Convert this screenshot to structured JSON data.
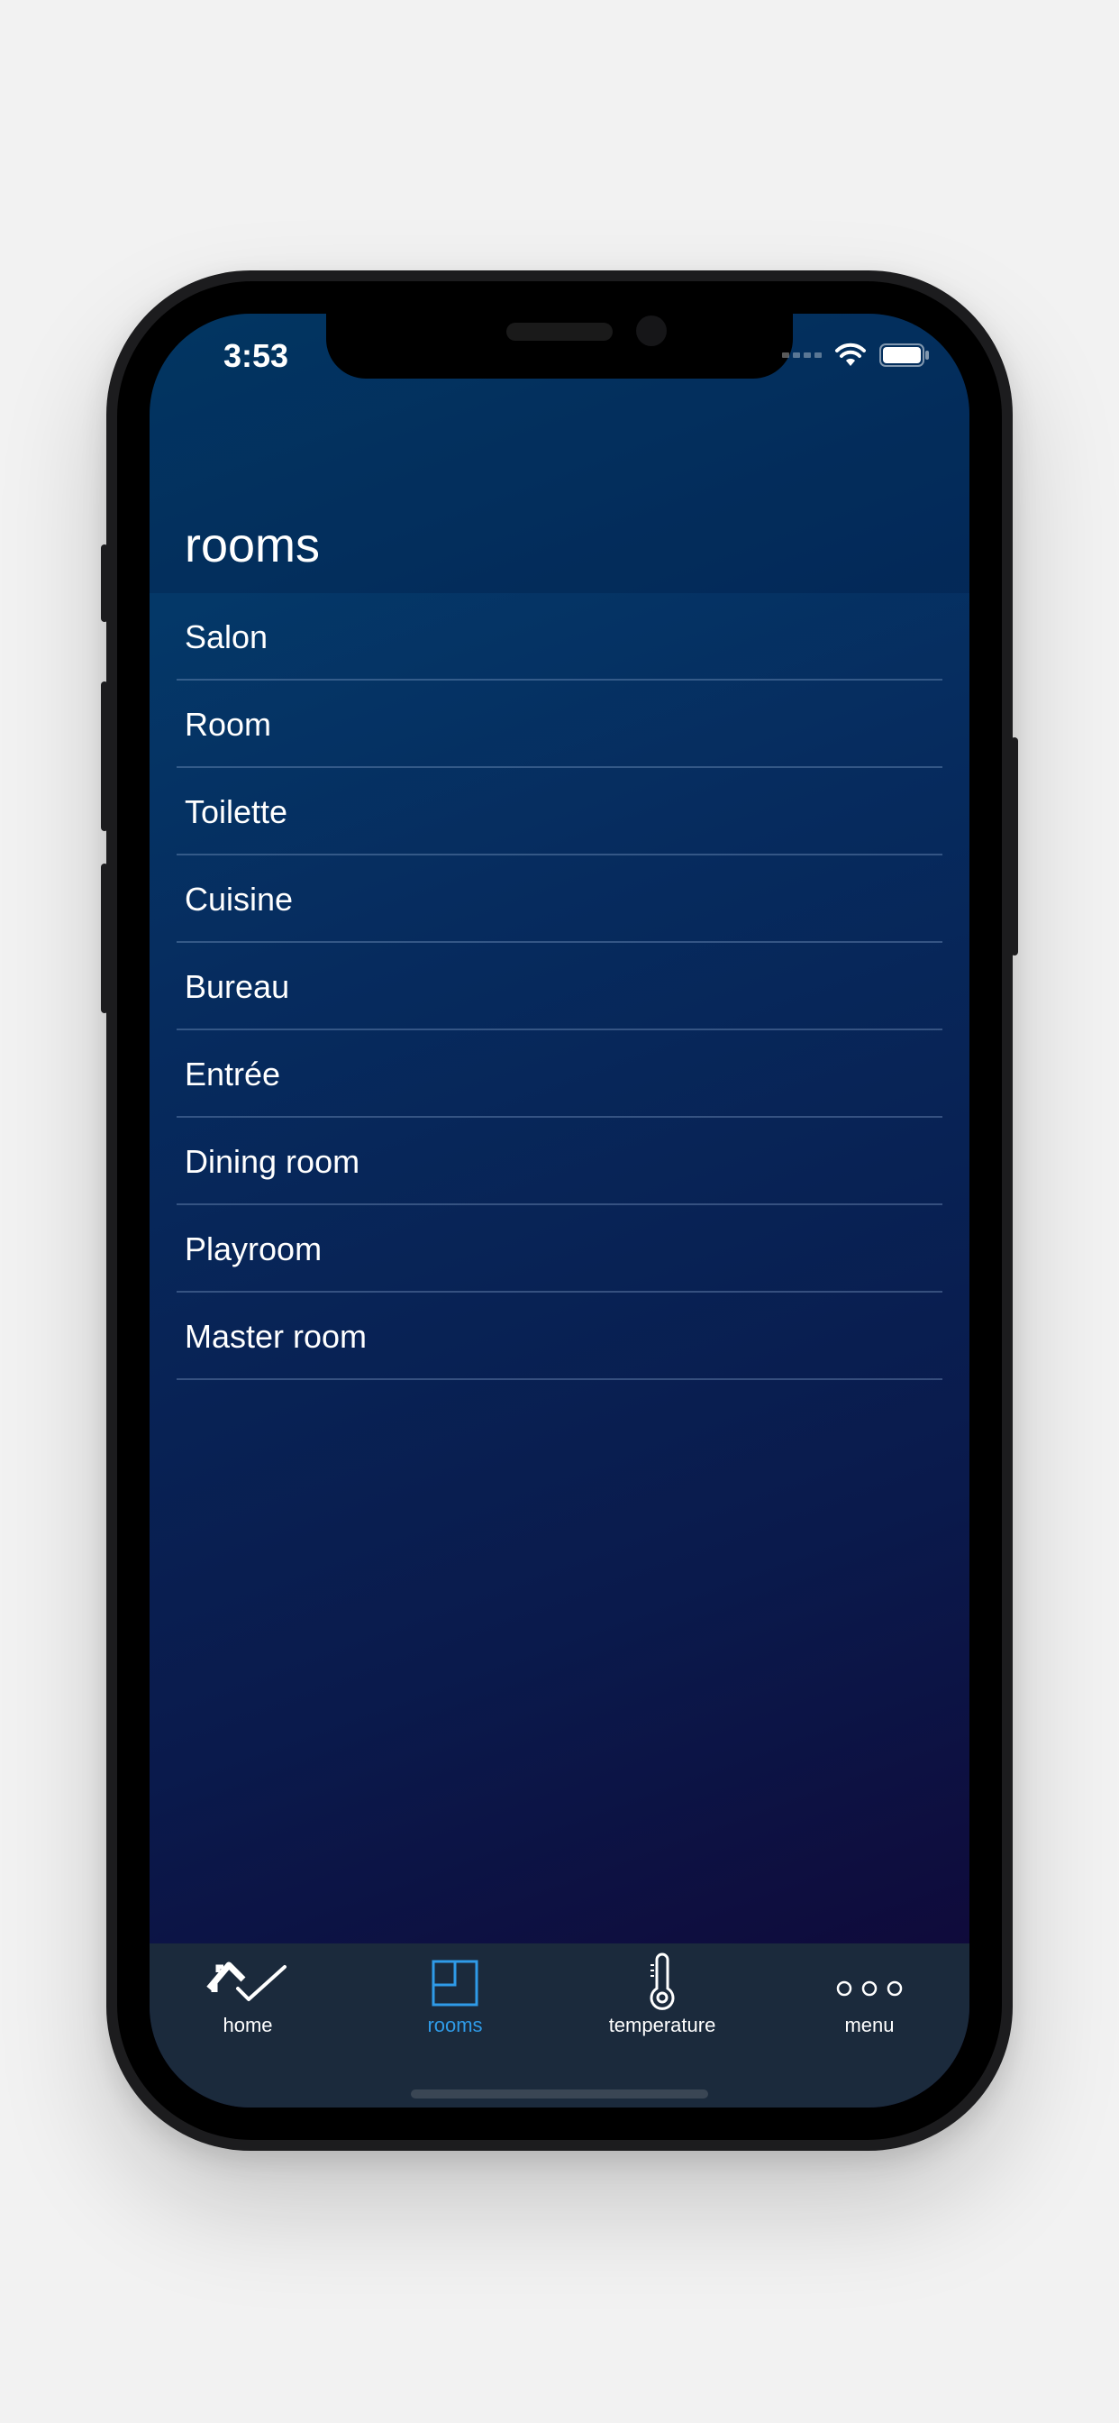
{
  "status_bar": {
    "time": "3:53"
  },
  "page": {
    "title": "rooms"
  },
  "rooms": [
    {
      "label": "Salon"
    },
    {
      "label": "Room"
    },
    {
      "label": "Toilette"
    },
    {
      "label": "Cuisine"
    },
    {
      "label": "Bureau"
    },
    {
      "label": "Entrée"
    },
    {
      "label": "Dining room"
    },
    {
      "label": "Playroom"
    },
    {
      "label": "Master room"
    }
  ],
  "tab_bar": {
    "tabs": [
      {
        "label": "home",
        "icon": "home-check-icon",
        "active": false
      },
      {
        "label": "rooms",
        "icon": "floorplan-icon",
        "active": true
      },
      {
        "label": "temperature",
        "icon": "thermometer-icon",
        "active": false
      },
      {
        "label": "menu",
        "icon": "more-dots-icon",
        "active": false
      }
    ]
  },
  "colors": {
    "accent": "#2f9be8",
    "tab_bar_bg": "#1b2a3c",
    "text": "#ffffff"
  }
}
